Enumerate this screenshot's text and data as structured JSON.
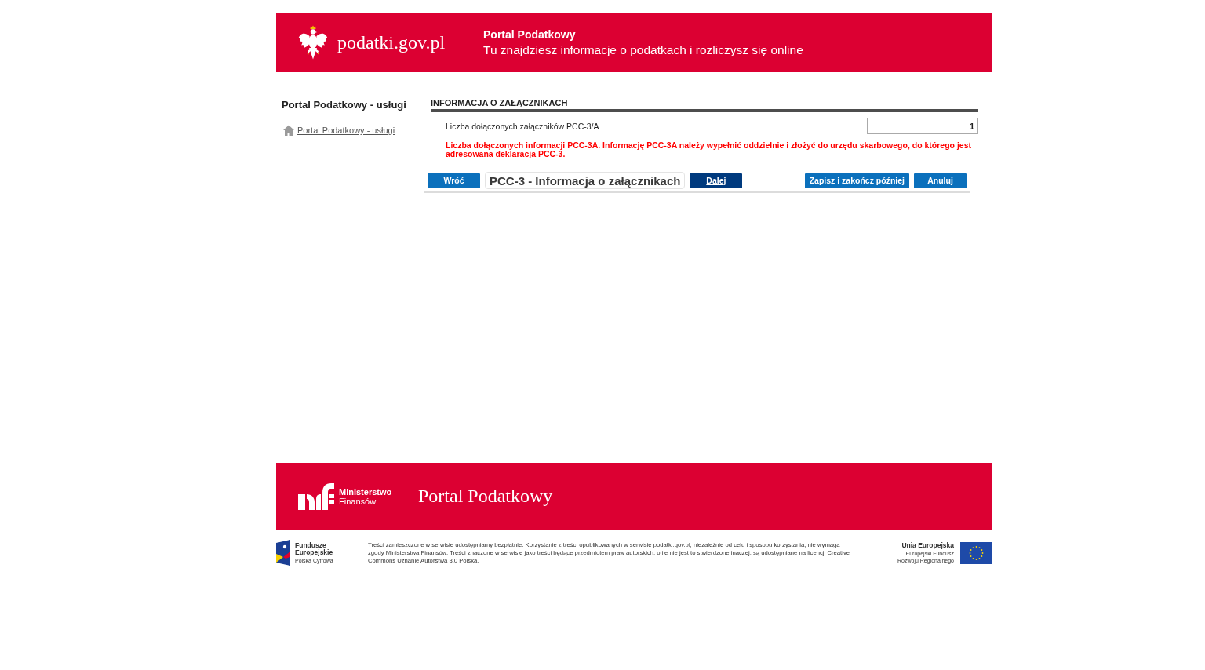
{
  "header": {
    "logo_text": "podatki.gov.pl",
    "title": "Portal Podatkowy",
    "subtitle": "Tu znajdziesz informacje o podatkach i rozliczysz się online"
  },
  "sidebar": {
    "title": "Portal Podatkowy - usługi",
    "links": [
      {
        "label": "Portal Podatkowy - usługi"
      }
    ]
  },
  "form": {
    "section_title": "INFORMACJA O ZAŁĄCZNIKACH",
    "fields": [
      {
        "label": "Liczba dołączonych załączników PCC-3/A",
        "value": "1"
      }
    ],
    "notice": "Liczba dołączonych informacji PCC-3A. Informację PCC-3A należy wypełnić oddzielnie i złożyć do urzędu skarbowego, do którego jest adresowana deklaracja PCC-3."
  },
  "action_bar": {
    "items": [
      {
        "kind": "back",
        "label": "Wróć"
      },
      {
        "kind": "title",
        "label": "PCC-3 - Informacja o załącznikach"
      },
      {
        "kind": "next",
        "label": "Dalej"
      }
    ],
    "right_buttons": [
      {
        "label": "Zapisz i zakończ później"
      },
      {
        "label": "Anuluj"
      }
    ]
  },
  "footer": {
    "ministry_lines": [
      "Ministerstwo",
      "Finansów"
    ],
    "title": "Portal Podatkowy"
  },
  "legal_strip": {
    "funds": {
      "name_lines": [
        "Fundusze",
        "Europejskie"
      ],
      "caption": "Polska Cyfrowa"
    },
    "notice": "Treści zamieszczone w serwisie udostępniamy bezpłatnie. Korzystanie z treści opublikowanych w serwisie podatki.gov.pl, niezależnie od celu i sposobu korzystania, nie wymaga zgody Ministerstwa Finansów. Treści znaczone w serwisie jako treści będące przedmiotem praw autorskich, o ile nie jest to stwierdzone inaczej, są udostępniane na licencji Creative Commons Uznanie Autorstwa 3.0 Polska.",
    "eu": {
      "name": "Unia Europejska",
      "fund_lines": [
        "Europejski Fundusz",
        "Rozwoju Regionalnego"
      ]
    }
  }
}
